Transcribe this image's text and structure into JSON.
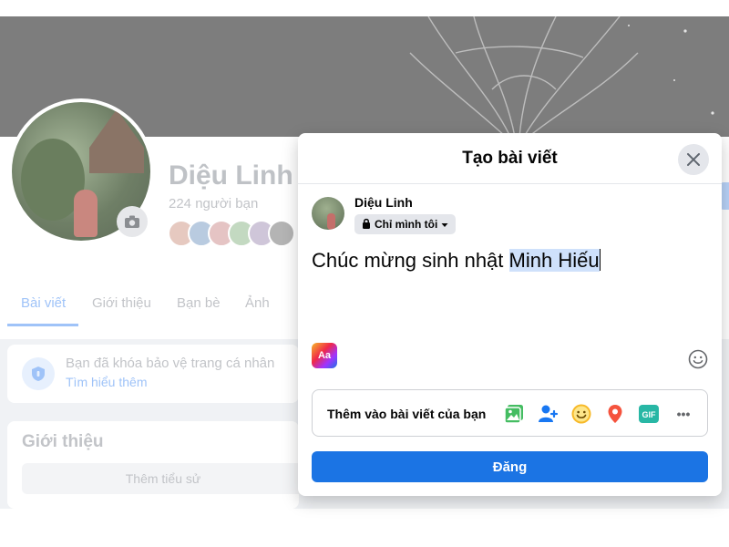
{
  "background_profile": {
    "name": "Diệu Linh",
    "friends_count": "224 người bạn",
    "tabs": [
      {
        "label": "Bài viết"
      },
      {
        "label": "Giới thiệu"
      },
      {
        "label": "Bạn bè"
      },
      {
        "label": "Ảnh"
      }
    ],
    "lock_notice": {
      "text": "Bạn đã khóa bảo vệ trang cá nhân",
      "link": "Tìm hiểu thêm"
    },
    "intro": {
      "title": "Giới thiệu",
      "add_bio_button": "Thêm tiểu sử"
    }
  },
  "modal": {
    "title": "Tạo bài viết",
    "close_icon": "close-icon",
    "author": {
      "name": "Diệu Linh",
      "privacy": "Chỉ mình tôi",
      "privacy_icon": "lock-icon"
    },
    "post_text_plain": "Chúc mừng sinh nhật ",
    "post_text_selected": "Minh Hiếu",
    "text_format_label": "Aa",
    "add_to_post_label": "Thêm vào bài viết của bạn",
    "add_icons": [
      "photo-video-icon",
      "tag-people-icon",
      "feeling-icon",
      "check-in-icon",
      "gif-icon",
      "more-icon"
    ],
    "gif_label": "GIF",
    "more_label": "•••",
    "post_button": "Đăng"
  },
  "colors": {
    "accent": "#1b74e4",
    "photo_green": "#45bd62",
    "tag_blue": "#1877f2",
    "feeling_yellow": "#f7b928",
    "checkin_red": "#f5533d",
    "gif_teal": "#28b7a5",
    "selection": "#cfe1fb"
  }
}
